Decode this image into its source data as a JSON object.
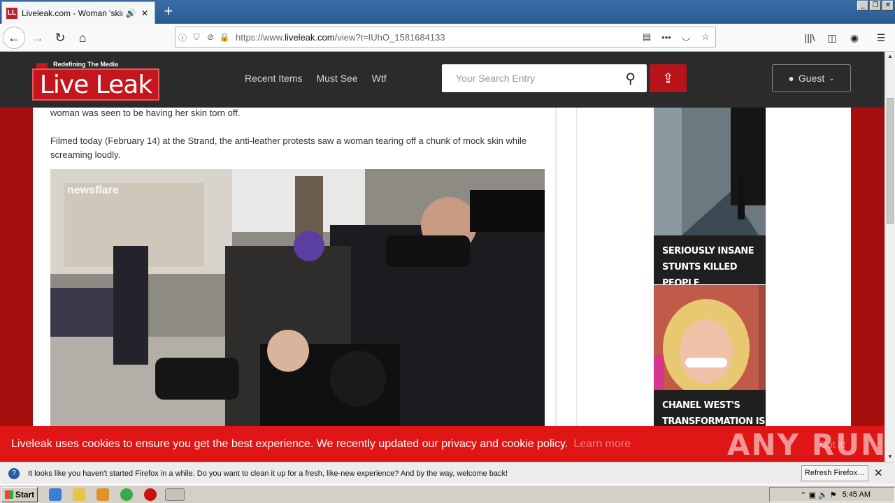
{
  "browser": {
    "tab_title": "Liveleak.com - Woman 'skinned",
    "new_tab": "+",
    "url_prefix": "https://www.",
    "url_domain": "liveleak.com",
    "url_path": "/view?t=IUhO_1581684133"
  },
  "site": {
    "logo_tagline": "Redefining The Media",
    "logo_text": "Live Leak",
    "nav": [
      "Recent Items",
      "Must See",
      "Wtf"
    ],
    "search_placeholder": "Your Search Entry",
    "guest_label": "Guest"
  },
  "article": {
    "para1": "woman was seen to be having her skin torn off.",
    "para2": "Filmed today (February 14) at the Strand, the anti-leather protests saw a woman tearing off a chunk of mock skin while screaming loudly.",
    "video_watermark": "newsflare"
  },
  "sidebar": {
    "items": [
      {
        "caption": "SERIOUSLY INSANE STUNTS KILLED PEOPLE"
      },
      {
        "caption": "CHANEL WEST'S TRANSFORMATION IS"
      }
    ]
  },
  "cookie": {
    "text": "Liveleak uses cookies to ensure you get the best experience. We recently updated our privacy and cookie policy.",
    "learn_more": "Learn more",
    "got_it": "Got it!"
  },
  "watermark": "ANY RUN",
  "notification": {
    "text": "It looks like you haven't started Firefox in a while. Do you want to clean it up for a fresh, like-new experience? And by the way, welcome back!",
    "button": "Refresh Firefox…"
  },
  "taskbar": {
    "start": "Start",
    "time": "5:45 AM"
  }
}
